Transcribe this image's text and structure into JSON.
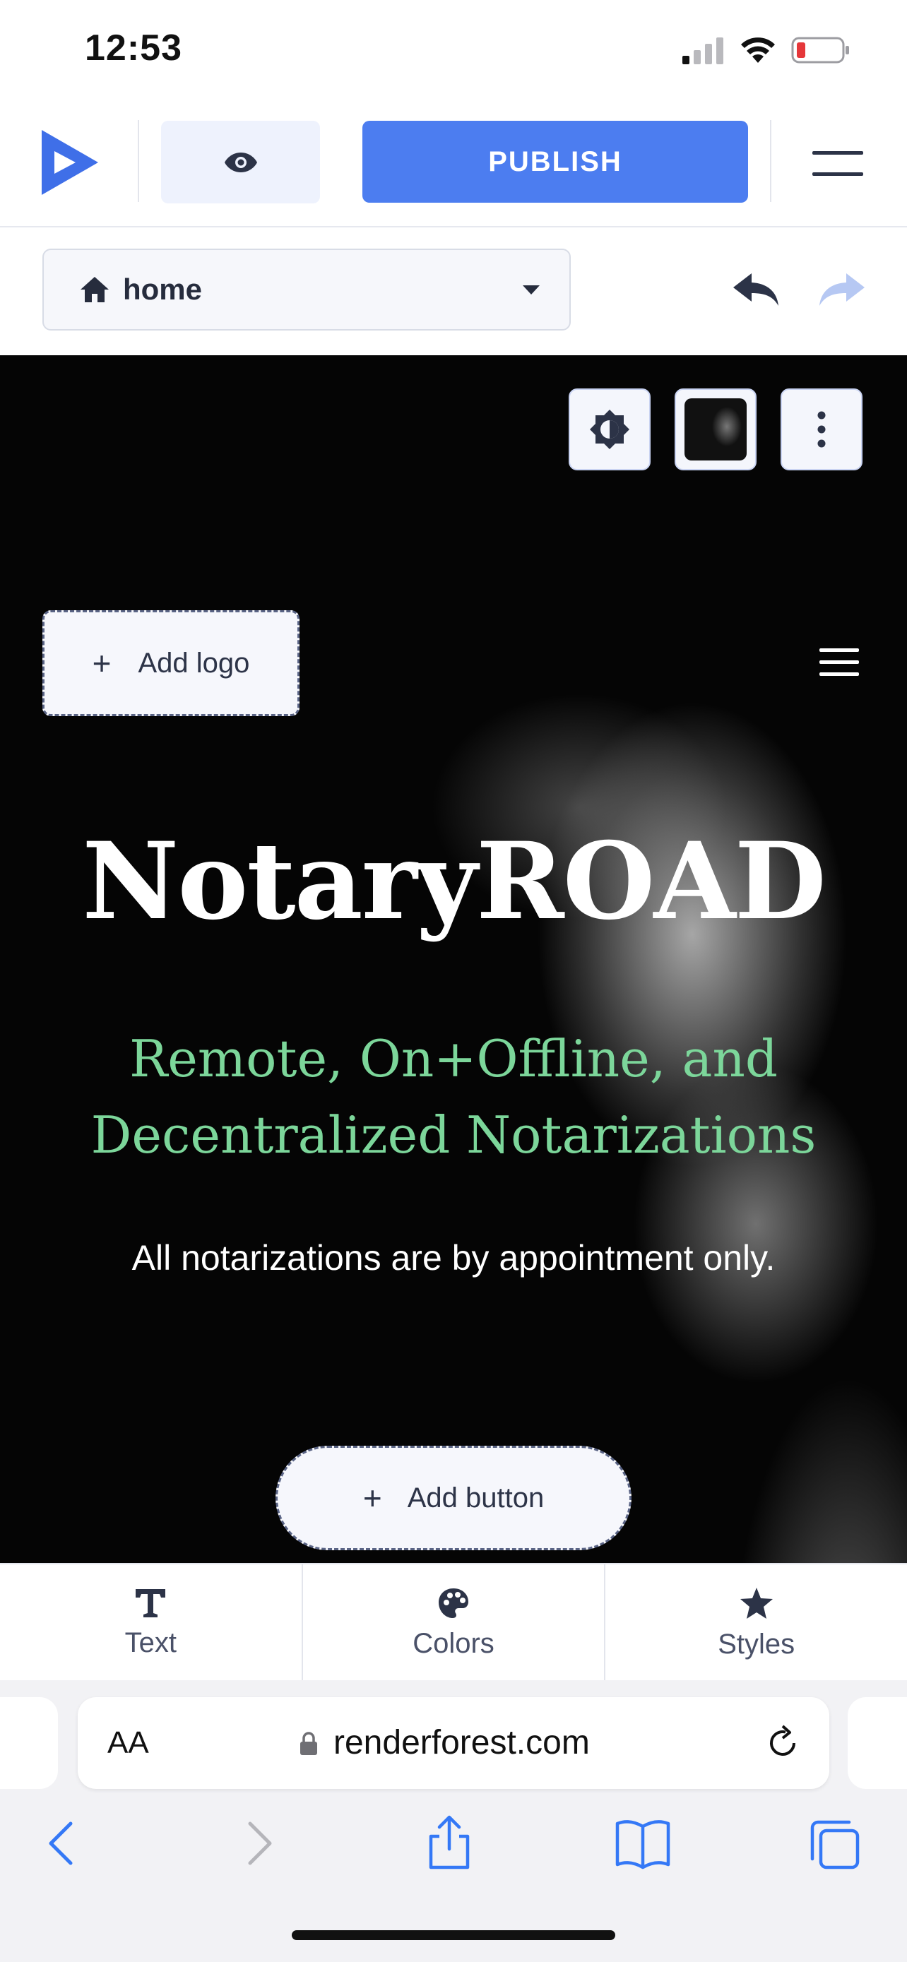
{
  "status_bar": {
    "time": "12:53"
  },
  "editor_header": {
    "publish_label": "PUBLISH",
    "page_selector": {
      "selected": "home"
    }
  },
  "hero": {
    "add_logo_label": "Add logo",
    "title": "NotaryROAD",
    "subtitle": "Remote, On+Offline, and Decentralized Notarizations",
    "text": "All notarizations are by appointment only.",
    "add_button_label": "Add button"
  },
  "bottom_toolbar": {
    "items": [
      {
        "label": "Text",
        "icon": "text-icon"
      },
      {
        "label": "Colors",
        "icon": "palette-icon"
      },
      {
        "label": "Styles",
        "icon": "star-icon"
      }
    ]
  },
  "browser": {
    "text_size_label": "AA",
    "url": "renderforest.com"
  },
  "colors": {
    "accent": "#4c7df0",
    "subtitle_green": "#7cd69a",
    "battery_low": "#e5373a"
  }
}
